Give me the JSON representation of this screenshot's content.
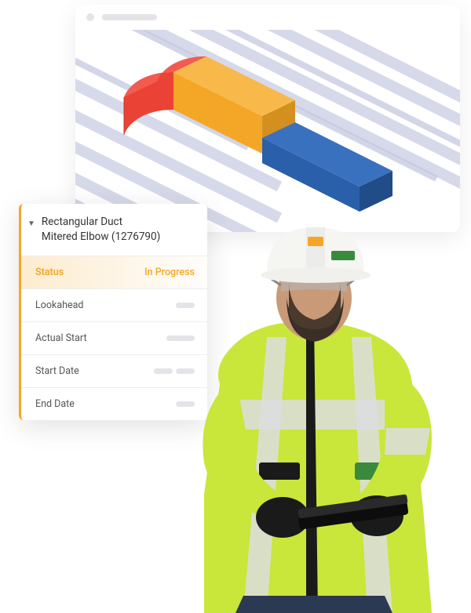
{
  "panel": {
    "title_line1": "Rectangular Duct",
    "title_line2": "Mitered Elbow (1276790)",
    "status_label": "Status",
    "status_value": "In Progress",
    "rows": {
      "lookahead": "Lookahead",
      "actual_start": "Actual Start",
      "start_date": "Start Date",
      "end_date": "End Date"
    }
  },
  "colors": {
    "accent": "#f4a726",
    "duct_red": "#ea4335",
    "duct_yellow": "#f4a726",
    "duct_blue": "#2a5faa"
  }
}
